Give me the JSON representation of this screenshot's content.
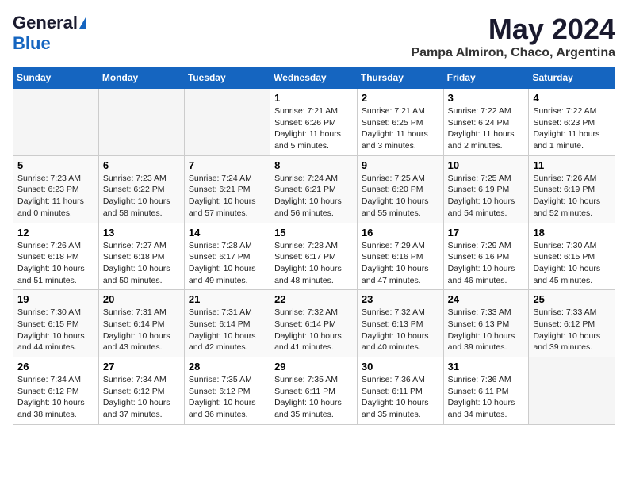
{
  "logo": {
    "general": "General",
    "blue": "Blue"
  },
  "title": "May 2024",
  "location": "Pampa Almiron, Chaco, Argentina",
  "weekdays": [
    "Sunday",
    "Monday",
    "Tuesday",
    "Wednesday",
    "Thursday",
    "Friday",
    "Saturday"
  ],
  "weeks": [
    [
      {
        "day": "",
        "info": ""
      },
      {
        "day": "",
        "info": ""
      },
      {
        "day": "",
        "info": ""
      },
      {
        "day": "1",
        "info": "Sunrise: 7:21 AM\nSunset: 6:26 PM\nDaylight: 11 hours\nand 5 minutes."
      },
      {
        "day": "2",
        "info": "Sunrise: 7:21 AM\nSunset: 6:25 PM\nDaylight: 11 hours\nand 3 minutes."
      },
      {
        "day": "3",
        "info": "Sunrise: 7:22 AM\nSunset: 6:24 PM\nDaylight: 11 hours\nand 2 minutes."
      },
      {
        "day": "4",
        "info": "Sunrise: 7:22 AM\nSunset: 6:23 PM\nDaylight: 11 hours\nand 1 minute."
      }
    ],
    [
      {
        "day": "5",
        "info": "Sunrise: 7:23 AM\nSunset: 6:23 PM\nDaylight: 11 hours\nand 0 minutes."
      },
      {
        "day": "6",
        "info": "Sunrise: 7:23 AM\nSunset: 6:22 PM\nDaylight: 10 hours\nand 58 minutes."
      },
      {
        "day": "7",
        "info": "Sunrise: 7:24 AM\nSunset: 6:21 PM\nDaylight: 10 hours\nand 57 minutes."
      },
      {
        "day": "8",
        "info": "Sunrise: 7:24 AM\nSunset: 6:21 PM\nDaylight: 10 hours\nand 56 minutes."
      },
      {
        "day": "9",
        "info": "Sunrise: 7:25 AM\nSunset: 6:20 PM\nDaylight: 10 hours\nand 55 minutes."
      },
      {
        "day": "10",
        "info": "Sunrise: 7:25 AM\nSunset: 6:19 PM\nDaylight: 10 hours\nand 54 minutes."
      },
      {
        "day": "11",
        "info": "Sunrise: 7:26 AM\nSunset: 6:19 PM\nDaylight: 10 hours\nand 52 minutes."
      }
    ],
    [
      {
        "day": "12",
        "info": "Sunrise: 7:26 AM\nSunset: 6:18 PM\nDaylight: 10 hours\nand 51 minutes."
      },
      {
        "day": "13",
        "info": "Sunrise: 7:27 AM\nSunset: 6:18 PM\nDaylight: 10 hours\nand 50 minutes."
      },
      {
        "day": "14",
        "info": "Sunrise: 7:28 AM\nSunset: 6:17 PM\nDaylight: 10 hours\nand 49 minutes."
      },
      {
        "day": "15",
        "info": "Sunrise: 7:28 AM\nSunset: 6:17 PM\nDaylight: 10 hours\nand 48 minutes."
      },
      {
        "day": "16",
        "info": "Sunrise: 7:29 AM\nSunset: 6:16 PM\nDaylight: 10 hours\nand 47 minutes."
      },
      {
        "day": "17",
        "info": "Sunrise: 7:29 AM\nSunset: 6:16 PM\nDaylight: 10 hours\nand 46 minutes."
      },
      {
        "day": "18",
        "info": "Sunrise: 7:30 AM\nSunset: 6:15 PM\nDaylight: 10 hours\nand 45 minutes."
      }
    ],
    [
      {
        "day": "19",
        "info": "Sunrise: 7:30 AM\nSunset: 6:15 PM\nDaylight: 10 hours\nand 44 minutes."
      },
      {
        "day": "20",
        "info": "Sunrise: 7:31 AM\nSunset: 6:14 PM\nDaylight: 10 hours\nand 43 minutes."
      },
      {
        "day": "21",
        "info": "Sunrise: 7:31 AM\nSunset: 6:14 PM\nDaylight: 10 hours\nand 42 minutes."
      },
      {
        "day": "22",
        "info": "Sunrise: 7:32 AM\nSunset: 6:14 PM\nDaylight: 10 hours\nand 41 minutes."
      },
      {
        "day": "23",
        "info": "Sunrise: 7:32 AM\nSunset: 6:13 PM\nDaylight: 10 hours\nand 40 minutes."
      },
      {
        "day": "24",
        "info": "Sunrise: 7:33 AM\nSunset: 6:13 PM\nDaylight: 10 hours\nand 39 minutes."
      },
      {
        "day": "25",
        "info": "Sunrise: 7:33 AM\nSunset: 6:12 PM\nDaylight: 10 hours\nand 39 minutes."
      }
    ],
    [
      {
        "day": "26",
        "info": "Sunrise: 7:34 AM\nSunset: 6:12 PM\nDaylight: 10 hours\nand 38 minutes."
      },
      {
        "day": "27",
        "info": "Sunrise: 7:34 AM\nSunset: 6:12 PM\nDaylight: 10 hours\nand 37 minutes."
      },
      {
        "day": "28",
        "info": "Sunrise: 7:35 AM\nSunset: 6:12 PM\nDaylight: 10 hours\nand 36 minutes."
      },
      {
        "day": "29",
        "info": "Sunrise: 7:35 AM\nSunset: 6:11 PM\nDaylight: 10 hours\nand 35 minutes."
      },
      {
        "day": "30",
        "info": "Sunrise: 7:36 AM\nSunset: 6:11 PM\nDaylight: 10 hours\nand 35 minutes."
      },
      {
        "day": "31",
        "info": "Sunrise: 7:36 AM\nSunset: 6:11 PM\nDaylight: 10 hours\nand 34 minutes."
      },
      {
        "day": "",
        "info": ""
      }
    ]
  ]
}
